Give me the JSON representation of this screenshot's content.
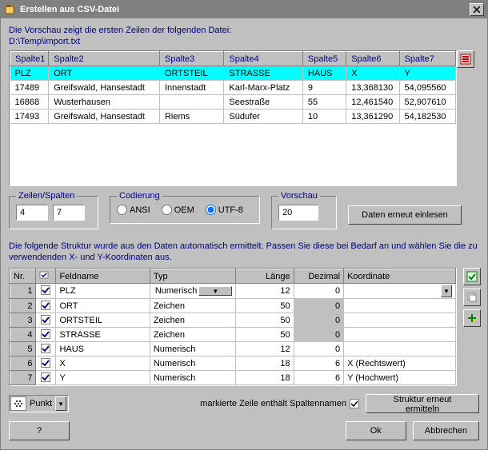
{
  "window": {
    "title": "Erstellen aus CSV-Datei"
  },
  "intro": {
    "line1": "Die Vorschau zeigt die ersten Zeilen der folgenden Datei:",
    "path": "D:\\Temp\\import.txt"
  },
  "preview": {
    "columns": [
      "Spalte1",
      "Spalte2",
      "Spalte3",
      "Spalte4",
      "Spalte5",
      "Spalte6",
      "Spalte7"
    ],
    "header_row": [
      "PLZ",
      "ORT",
      "ORTSTEIL",
      "STRASSE",
      "HAUS",
      "X",
      "Y"
    ],
    "rows": [
      [
        "17489",
        "Greifswald, Hansestadt",
        "Innenstadt",
        "Karl-Marx-Platz",
        "9",
        "13,368130",
        "54,095560"
      ],
      [
        "16868",
        "Wusterhausen",
        "",
        "Seestraße",
        "55",
        "12,461540",
        "52,907610"
      ],
      [
        "17493",
        "Greifswald, Hansestadt",
        "Riems",
        "Südufer",
        "10",
        "13,361290",
        "54,182530"
      ]
    ]
  },
  "groups": {
    "rowscols": {
      "title": "Zeilen/Spalten",
      "rows": "4",
      "cols": "7"
    },
    "encoding": {
      "title": "Codierung",
      "ansi": "ANSI",
      "oem": "OEM",
      "utf8": "UTF-8",
      "selected": "utf8"
    },
    "preview": {
      "title": "Vorschau",
      "count": "20"
    },
    "reload_btn": "Daten erneut einlesen"
  },
  "desc2": "Die folgende Struktur wurde aus den Daten automatisch ermittelt. Passen Sie diese bei Bedarf an und wählen Sie die zu verwendenden X- und Y-Koordinaten aus.",
  "struct": {
    "headers": {
      "nr": "Nr.",
      "use": "",
      "field": "Feldname",
      "type": "Typ",
      "len": "Länge",
      "dec": "Dezimal",
      "coord": "Koordinate"
    },
    "rows": [
      {
        "nr": "1",
        "use": true,
        "field": "PLZ",
        "type": "Numerisch",
        "len": "12",
        "dec": "0",
        "dec_ro": false,
        "coord": "",
        "coord_combo": true
      },
      {
        "nr": "2",
        "use": true,
        "field": "ORT",
        "type": "Zeichen",
        "len": "50",
        "dec": "0",
        "dec_ro": true,
        "coord": ""
      },
      {
        "nr": "3",
        "use": true,
        "field": "ORTSTEIL",
        "type": "Zeichen",
        "len": "50",
        "dec": "0",
        "dec_ro": true,
        "coord": ""
      },
      {
        "nr": "4",
        "use": true,
        "field": "STRASSE",
        "type": "Zeichen",
        "len": "50",
        "dec": "0",
        "dec_ro": true,
        "coord": ""
      },
      {
        "nr": "5",
        "use": true,
        "field": "HAUS",
        "type": "Numerisch",
        "len": "12",
        "dec": "0",
        "dec_ro": false,
        "coord": ""
      },
      {
        "nr": "6",
        "use": true,
        "field": "X",
        "type": "Numerisch",
        "len": "18",
        "dec": "6",
        "dec_ro": false,
        "coord": "X (Rechtswert)"
      },
      {
        "nr": "7",
        "use": true,
        "field": "Y",
        "type": "Numerisch",
        "len": "18",
        "dec": "6",
        "dec_ro": false,
        "coord": "Y (Hochwert)"
      }
    ]
  },
  "bottom": {
    "point_label": "Punkt",
    "header_chk_label": "markierte Zeile enthält Spaltennamen",
    "header_chk": true,
    "detect_btn": "Struktur erneut ermitteln"
  },
  "buttons": {
    "help": "?",
    "ok": "Ok",
    "cancel": "Abbrechen"
  }
}
